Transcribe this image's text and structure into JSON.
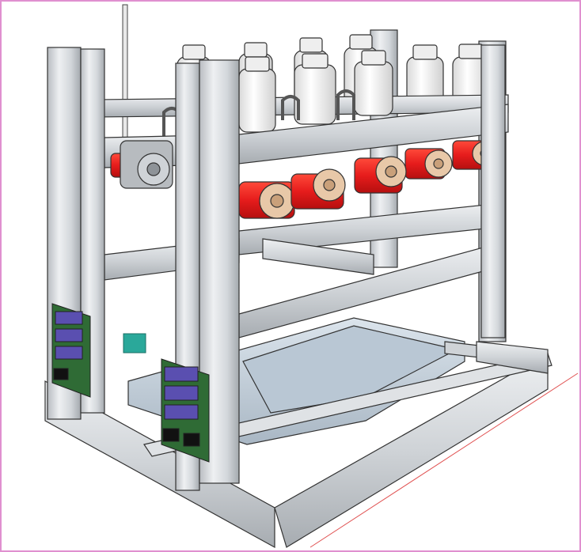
{
  "scene": {
    "description_visible_text": "",
    "colors": {
      "frame_border": "#e090d0",
      "aluminum_light": "#e4e6e8",
      "aluminum_mid": "#c9cdd1",
      "aluminum_dark": "#9ea3a8",
      "pump_red": "#e61c1c",
      "pump_cap": "#e8c8a8",
      "bottle_white": "#f4f4f4",
      "tray_blue": "#c8d4e0",
      "pcb_green": "#2f6b35",
      "connector_purple": "#5a4fb0",
      "teal_block": "#2aa89a"
    },
    "counts": {
      "bottles": 11,
      "pumps": 6,
      "circuit_boards": 2
    }
  }
}
